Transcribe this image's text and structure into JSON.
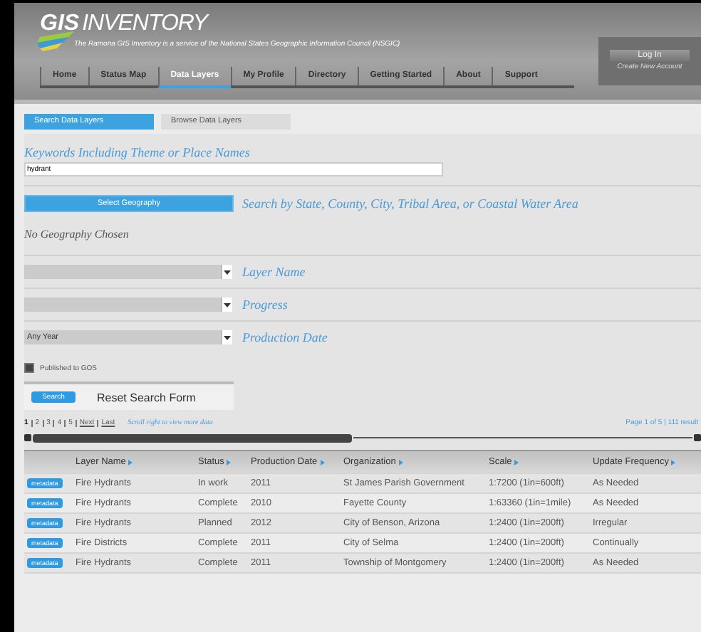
{
  "header": {
    "logo": "GIS",
    "logo_suffix": "INVENTORY",
    "tagline": "The Ramona GIS Inventory is a service of the National States Geographic Information Council (NSGIC)",
    "nav": [
      {
        "label": "Home",
        "selected": false
      },
      {
        "label": "Status Map",
        "selected": false
      },
      {
        "label": "Data Layers",
        "selected": true
      },
      {
        "label": "My Profile",
        "selected": false
      },
      {
        "label": "Directory",
        "selected": false
      },
      {
        "label": "Getting Started",
        "selected": false
      },
      {
        "label": "About",
        "selected": false
      },
      {
        "label": "Support",
        "selected": false
      }
    ],
    "login_button": "Log In",
    "create_account": "Create New Account"
  },
  "subtabs": [
    {
      "label": "Search Data Layers",
      "selected": true
    },
    {
      "label": "Browse Data Layers",
      "selected": false
    }
  ],
  "keywords": {
    "label": "Keywords Including Theme or Place Names",
    "value": "hydrant"
  },
  "geography": {
    "button": "Select Geography",
    "label": "Search by State, County, City, Tribal Area, or Coastal Water Area",
    "status": "No Geography Chosen"
  },
  "selects": [
    {
      "label": "Layer Name"
    },
    {
      "label": "Progress"
    },
    {
      "value": "Any Year",
      "label": "Production Date"
    }
  ],
  "published": {
    "label": "Published to GOS",
    "checked": true
  },
  "search_button": "Search",
  "reset": "Reset Search Form",
  "pagination": {
    "pages": [
      {
        "label": "1",
        "selected": true
      },
      {
        "label": "2",
        "selected": false
      },
      {
        "label": "3",
        "selected": false
      },
      {
        "label": "4",
        "selected": false
      },
      {
        "label": "5",
        "selected": false
      }
    ],
    "next": "Next",
    "last": "Last",
    "hint": "Scroll right to view more data",
    "summary": "Page 1 of 5 | 111 result"
  },
  "table": {
    "columns": [
      "Layer Name",
      "Status",
      "Production Date",
      "Organization",
      "Scale",
      "Update Frequency"
    ],
    "rows": [
      {
        "badge": "metadata",
        "cells": [
          "Fire Hydrants",
          "In work",
          "2011",
          "St James Parish Government",
          "1:7200 (1in=600ft)",
          "As Needed"
        ]
      },
      {
        "badge": "metadata",
        "cells": [
          "Fire Hydrants",
          "Complete",
          "2010",
          "Fayette County",
          "1:63360 (1in=1mile)",
          "As Needed"
        ]
      },
      {
        "badge": "metadata",
        "cells": [
          "Fire Hydrants",
          "Planned",
          "2012",
          "City of Benson, Arizona",
          "1:2400 (1in=200ft)",
          "Irregular"
        ]
      },
      {
        "badge": "metadata",
        "cells": [
          "Fire Districts",
          "Complete",
          "2011",
          "City of Selma",
          "1:2400 (1in=200ft)",
          "Continually"
        ]
      },
      {
        "badge": "metadata",
        "cells": [
          "Fire Hydrants",
          "Complete",
          "2011",
          "Township of Montgomery",
          "1:2400 (1in=200ft)",
          "As Needed"
        ]
      }
    ]
  }
}
